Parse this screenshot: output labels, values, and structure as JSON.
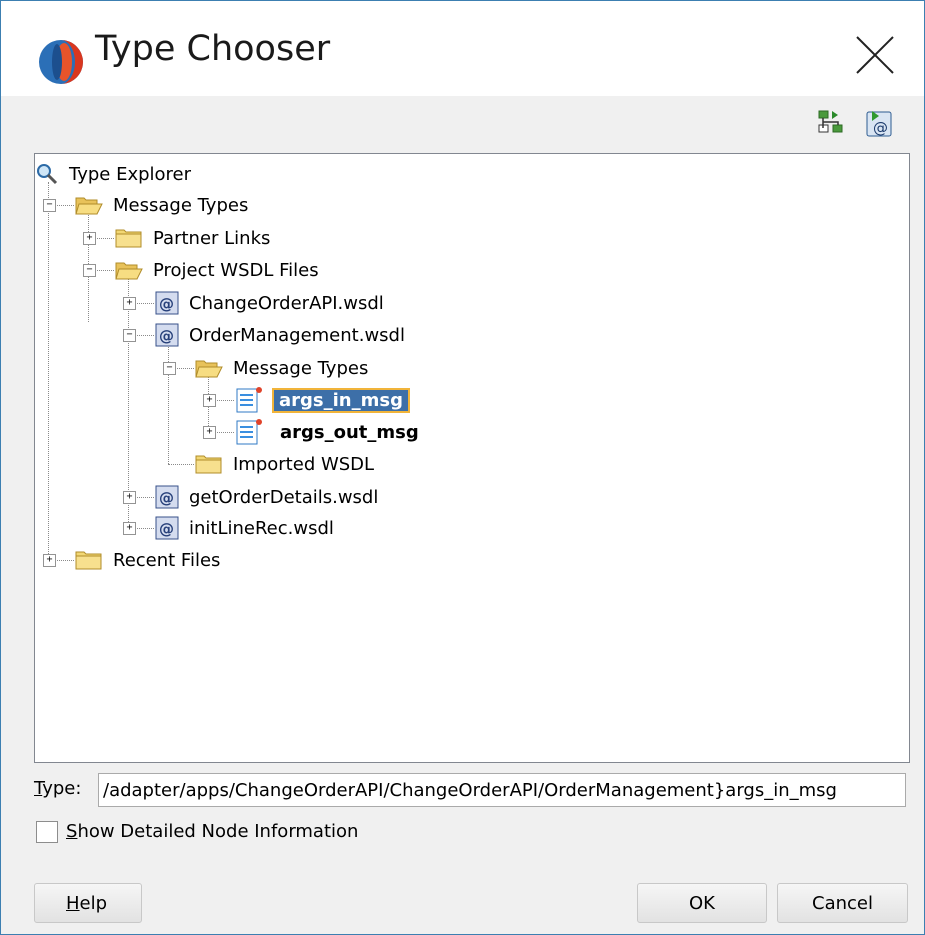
{
  "window": {
    "title": "Type Chooser",
    "close_icon": "close-x-icon",
    "logo_icon": "oracle-jdeveloper-logo-icon"
  },
  "toolbar": {
    "buttons": [
      {
        "icon": "import-schema-icon"
      },
      {
        "icon": "import-wsdl-icon"
      }
    ]
  },
  "tree": {
    "nodes": [
      {
        "label": "Type Explorer",
        "icon": "magnifier-icon",
        "level": 0
      },
      {
        "label": "Message Types",
        "icon": "open-folder-icon",
        "level": 0,
        "expanded": true
      },
      {
        "label": "Partner Links",
        "icon": "folder-icon",
        "level": 1,
        "expanded": false
      },
      {
        "label": "Project WSDL Files",
        "icon": "open-folder-icon",
        "level": 1,
        "expanded": true
      },
      {
        "label": "ChangeOrderAPI.wsdl",
        "icon": "wsdl-icon",
        "level": 2,
        "expanded": false
      },
      {
        "label": "OrderManagement.wsdl",
        "icon": "wsdl-icon",
        "level": 2,
        "expanded": true
      },
      {
        "label": "Message Types",
        "icon": "open-folder-icon",
        "level": 3,
        "expanded": true
      },
      {
        "label": "args_in_msg",
        "icon": "message-icon",
        "level": 4,
        "expanded": false,
        "selected": true
      },
      {
        "label": "args_out_msg",
        "icon": "message-icon",
        "level": 4,
        "expanded": false
      },
      {
        "label": "Imported WSDL",
        "icon": "folder-icon",
        "level": 3
      },
      {
        "label": "getOrderDetails.wsdl",
        "icon": "wsdl-icon",
        "level": 2,
        "expanded": false
      },
      {
        "label": "initLineRec.wsdl",
        "icon": "wsdl-icon",
        "level": 2,
        "expanded": false
      },
      {
        "label": "Recent Files",
        "icon": "folder-icon",
        "level": 0,
        "expanded": false
      }
    ]
  },
  "type_field": {
    "label": "Type:",
    "value": "/adapter/apps/ChangeOrderAPI/ChangeOrderAPI/OrderManagement}args_in_msg"
  },
  "detail_checkbox": {
    "label": "Show Detailed Node Information",
    "checked": false
  },
  "buttons": {
    "help": "Help",
    "ok": "OK",
    "cancel": "Cancel"
  }
}
